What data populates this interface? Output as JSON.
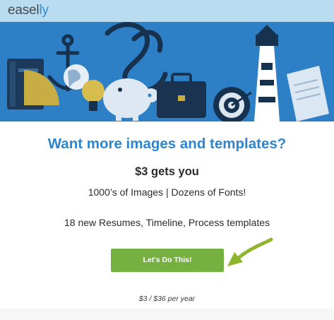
{
  "brand": {
    "logo_prefix": "easel",
    "logo_accent": "ly"
  },
  "promo": {
    "headline": "Want more images and templates?",
    "subheadline": "$3 gets you",
    "feature_line_1": "1000’s of Images | Dozens of Fonts!",
    "feature_line_2": "18 new Resumes, Timeline, Process templates",
    "cta_label": "Let's Do This!",
    "price_note": "$3 / $36 per year"
  },
  "hero": {
    "illustration_items": [
      "book-icon",
      "anchor-icon",
      "globe-icon",
      "piggy-bank-icon",
      "briefcase-icon",
      "target-icon",
      "lighthouse-icon",
      "document-icon"
    ]
  },
  "colors": {
    "topbar": "#b9dcf1",
    "hero_bg": "#2e80c6",
    "headline": "#2d86cd",
    "cta_bg": "#76b041",
    "arrow": "#8fb52a"
  }
}
